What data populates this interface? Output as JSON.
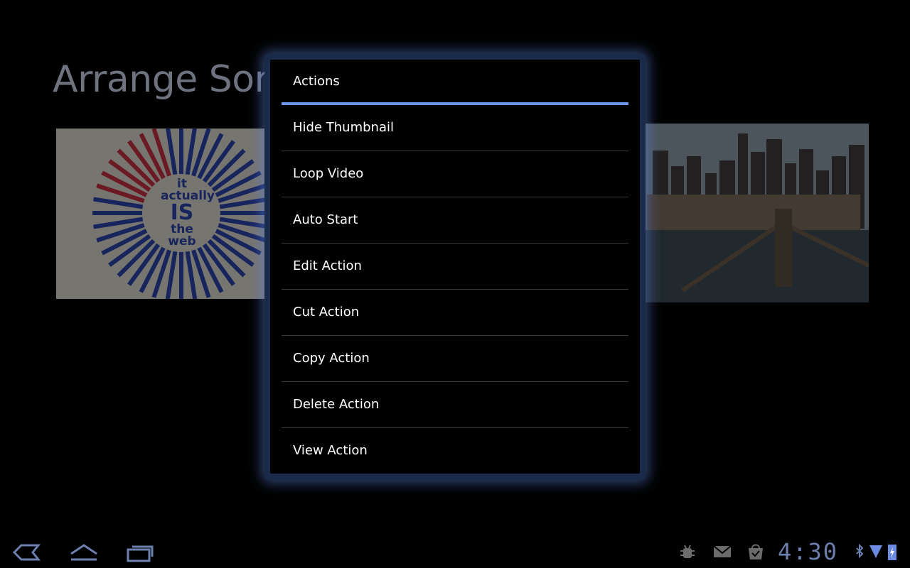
{
  "background": {
    "title": "Arrange Som",
    "thumbnail_left_text": {
      "line1": "it",
      "line2": "actually",
      "line3": "IS",
      "line4": "the web"
    }
  },
  "dialog": {
    "title": "Actions",
    "items": [
      {
        "label": "Hide Thumbnail"
      },
      {
        "label": "Loop Video"
      },
      {
        "label": "Auto Start"
      },
      {
        "label": "Edit Action"
      },
      {
        "label": "Cut Action"
      },
      {
        "label": "Copy Action"
      },
      {
        "label": "Delete Action"
      },
      {
        "label": "View Action"
      }
    ],
    "accent_color": "#6d95e8"
  },
  "system_bar": {
    "time": "4:30",
    "icons": [
      "back-icon",
      "home-icon",
      "recent-apps-icon",
      "debug-icon",
      "gmail-icon",
      "market-icon",
      "bluetooth-icon",
      "wifi-icon",
      "battery-icon"
    ]
  }
}
